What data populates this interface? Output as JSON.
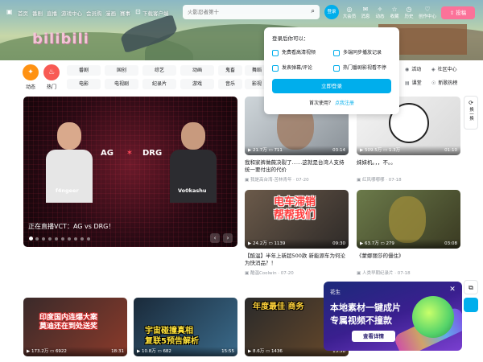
{
  "nav": {
    "left": [
      "首页",
      "番剧",
      "直播",
      "游戏中心",
      "会员购",
      "漫画",
      "赛事"
    ],
    "download": "下载客户端",
    "search_placeholder": "火影忍者第十",
    "login": "登录",
    "right": [
      {
        "icon": "vip-icon",
        "label": "大会员",
        "glyph": "◎"
      },
      {
        "icon": "message-icon",
        "label": "消息",
        "glyph": "✉"
      },
      {
        "icon": "dynamic-icon",
        "label": "动态",
        "glyph": "✧"
      },
      {
        "icon": "favorite-icon",
        "label": "收藏",
        "glyph": "☆"
      },
      {
        "icon": "history-icon",
        "label": "历史",
        "glyph": "◷"
      },
      {
        "icon": "creation-icon",
        "label": "创作中心",
        "glyph": "♡"
      }
    ],
    "upload": "投稿"
  },
  "banner": {
    "logo": "bilibili"
  },
  "quick": {
    "dynamic": "动态",
    "hot": "热门"
  },
  "categories": {
    "row1": [
      "番剧",
      "国创",
      "综艺",
      "动画",
      "鬼畜",
      "舞蹈"
    ],
    "row2": [
      "电影",
      "电视剧",
      "纪录片",
      "游戏",
      "音乐",
      "影视"
    ]
  },
  "side_links": [
    {
      "glyph": "▣",
      "label": "专栏"
    },
    {
      "glyph": "◉",
      "label": "活动"
    },
    {
      "glyph": "◈",
      "label": "社区中心"
    },
    {
      "glyph": "▤",
      "label": "课堂"
    },
    {
      "glyph": "☉",
      "label": "新歌热榜"
    }
  ],
  "login_popup": {
    "title": "登录后你可以：",
    "benefits": [
      "免费看高清视频",
      "多端同步播放记录",
      "发表弹幕/评论",
      "热门番剧影视看不停"
    ],
    "button": "立即登录",
    "first_use": "首次使用？",
    "register": "点我注册"
  },
  "carousel": {
    "caption": "正在直播VCT：AG vs DRG！",
    "player_left": "f4ngeer",
    "player_right": "Vo0kashu",
    "team_left": "AG",
    "team_right": "DRG",
    "dots": 10,
    "active_dot": 0
  },
  "videos": [
    {
      "views": "21.7万",
      "comments": "711",
      "duration": "03:14",
      "title": "我和家裤做薇决裂了……这就是台湾人支持统一要付出的代价",
      "author": "我是高台湾-苦林青年 · 07-20",
      "overlay": ""
    },
    {
      "views": "509.5万",
      "comments": "1.3万",
      "duration": "01:10",
      "title": "妹妹机。，，不。。",
      "author": "红风哪哪哪 · 07-18",
      "overlay": ""
    },
    {
      "views": "24.2万",
      "comments": "1139",
      "duration": "09:30",
      "title": "【酷温】半年上新超500款 新能源车为何沦为快消品？！",
      "author": "酷温Coolwin · 07-20",
      "overlay": "电车滞销\n帮帮我们"
    },
    {
      "views": "63.7万",
      "comments": "279",
      "duration": "03:08",
      "title": "《蒙娜丽莎的僵住》",
      "author": "人类早期纪录片 · 07-18",
      "overlay": ""
    },
    {
      "views": "173.2万",
      "comments": "6922",
      "duration": "18:31",
      "title": "印度国内连爆大案 莫迪还在到处送奖",
      "author": "",
      "overlay": "印度国内连爆大案\n莫迪还在到处送奖"
    },
    {
      "views": "10.8万",
      "comments": "682",
      "duration": "15:55",
      "title": "宇宙碰撞真相 复联5预告解析",
      "author": "",
      "overlay": "宇宙碰撞真相\n复联5预告解析"
    },
    {
      "views": "8.6万",
      "comments": "1436",
      "duration": "13:58",
      "title": "年度最佳 商务",
      "author": "",
      "overlay": "年度最佳 商务"
    }
  ],
  "refresh": {
    "label": "换一换"
  },
  "ad": {
    "brand": "花生",
    "line1": "本地素材一键成片",
    "line2": "专属视频不撞款",
    "cta": "查看详情"
  }
}
